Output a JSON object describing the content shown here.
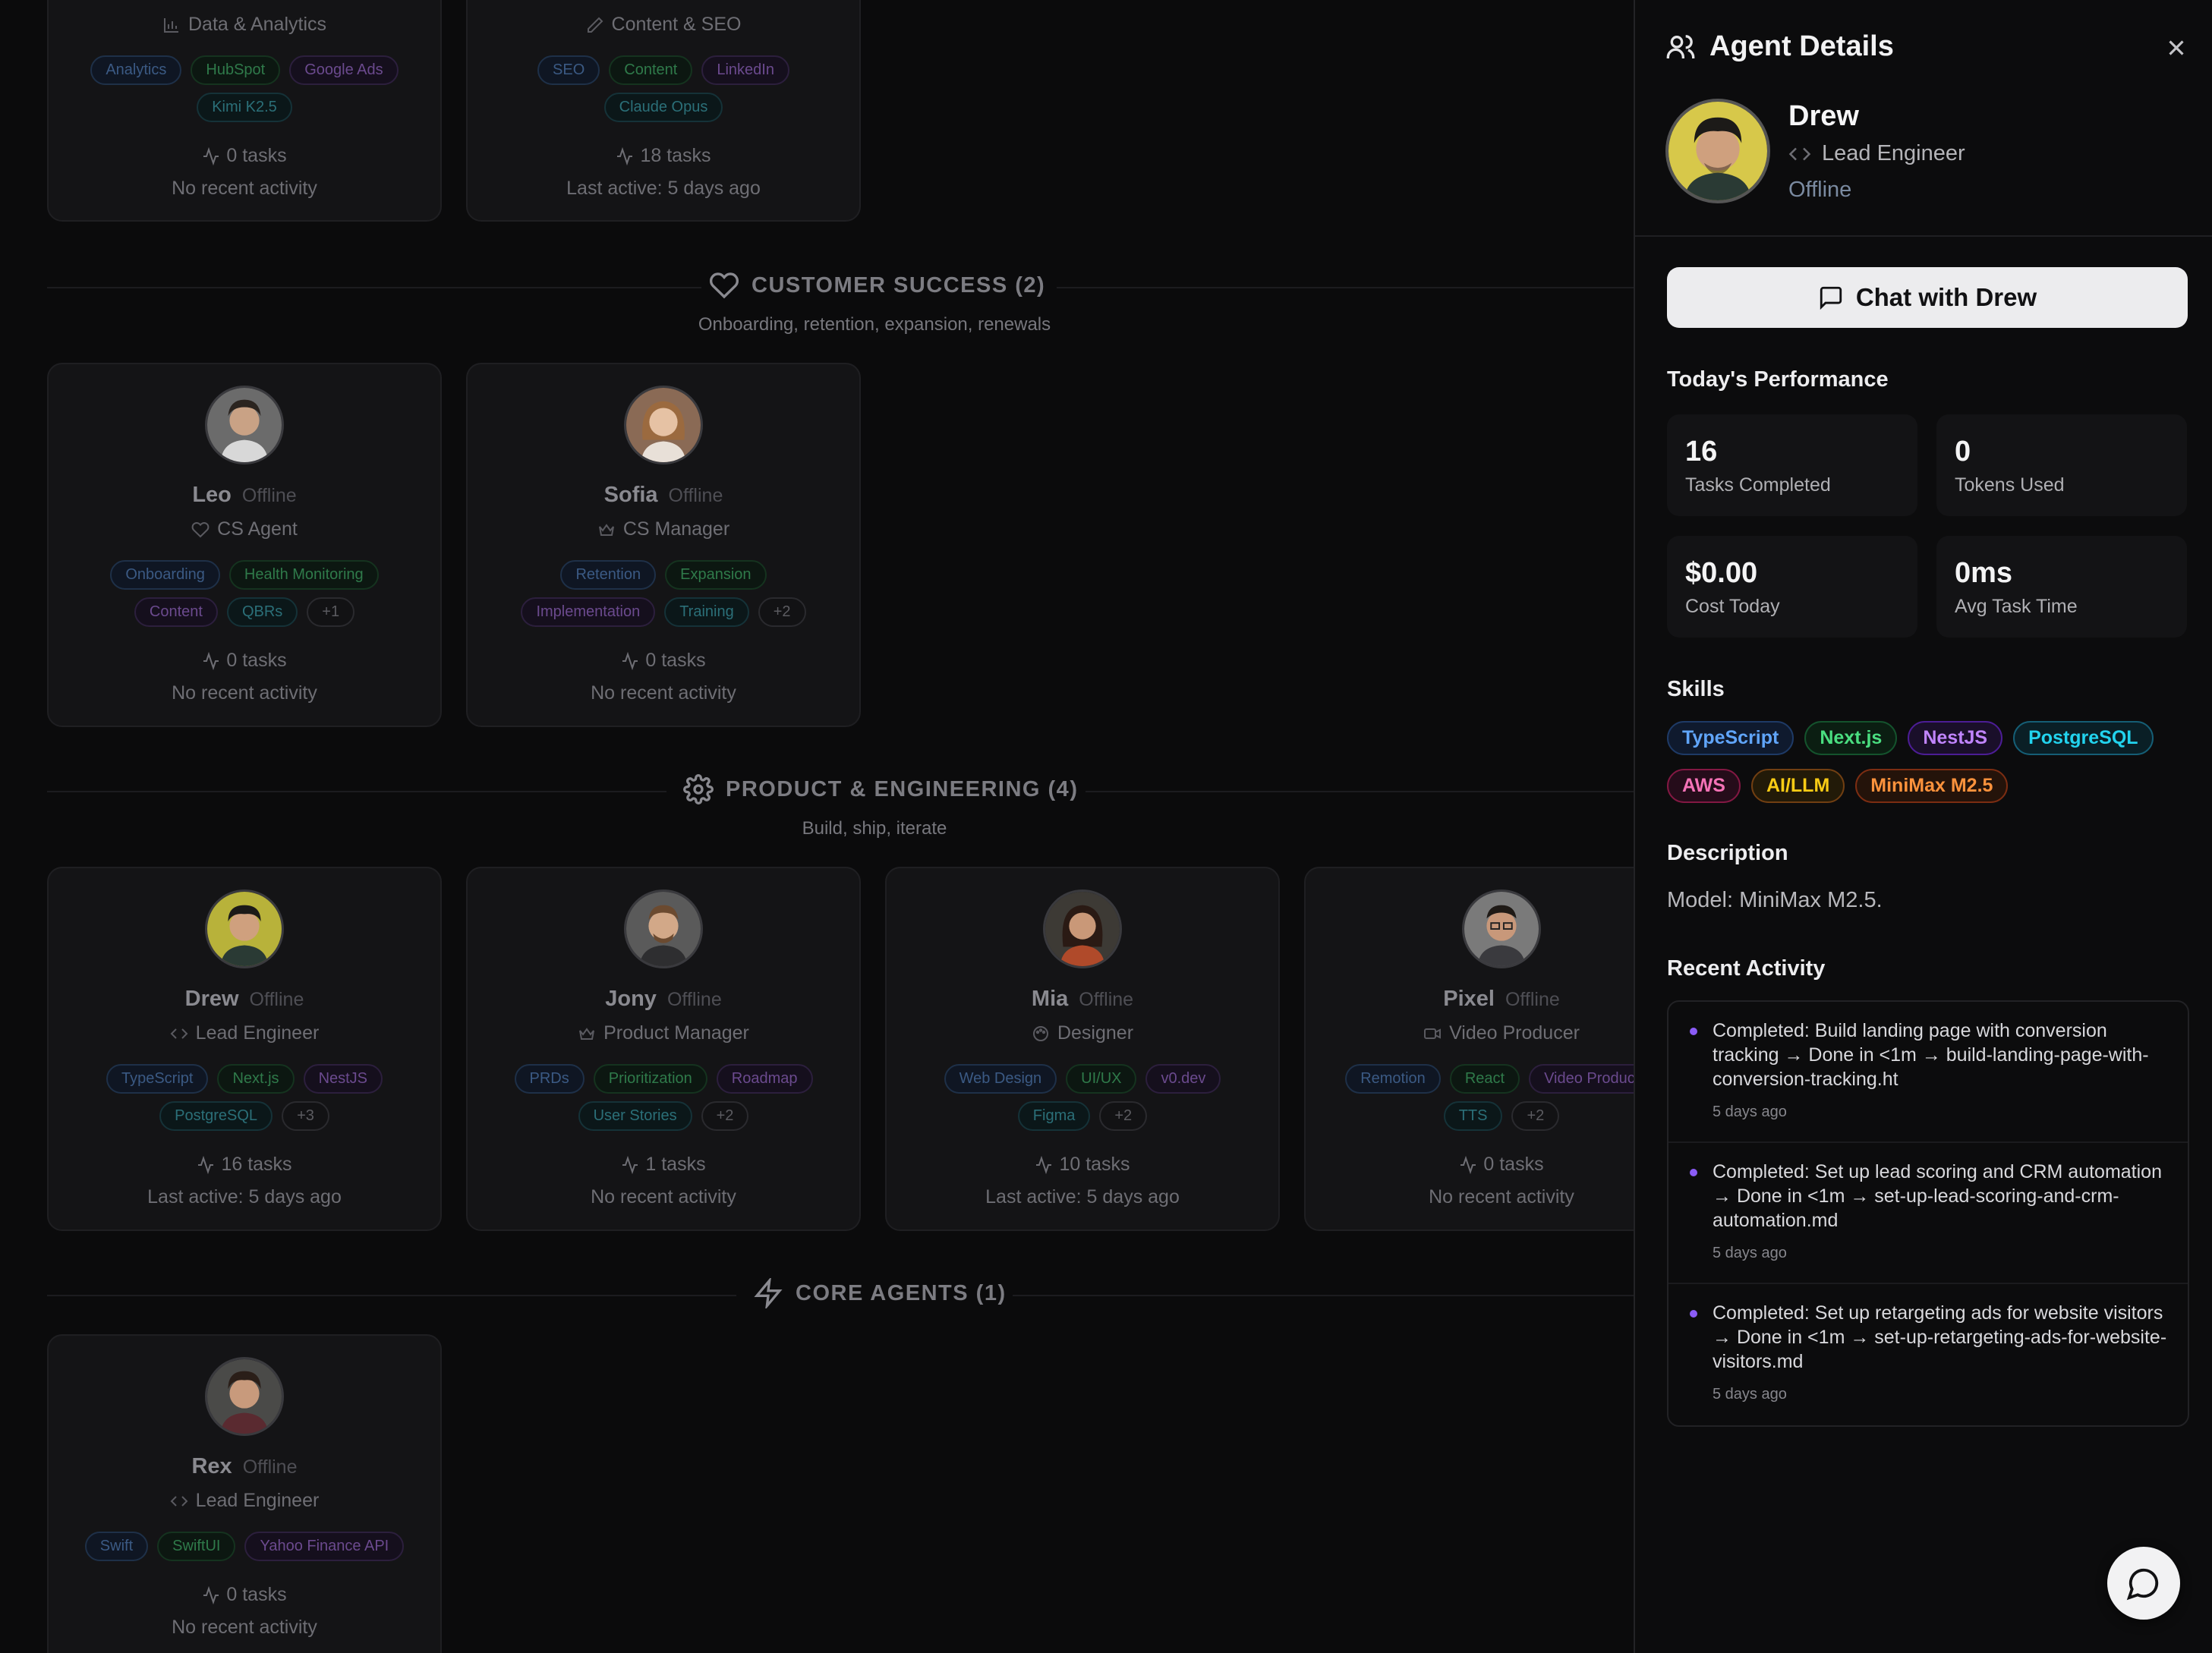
{
  "colors": {
    "accent_dot": "#8b5cf6",
    "chip_blue": "#3b82f6",
    "chip_green": "#22c55e",
    "chip_purple": "#a855f7",
    "chip_cyan": "#06b6d4",
    "chip_pink": "#ec4899",
    "chip_yellow": "#eab308",
    "chip_orange": "#f97316"
  },
  "top_row": {
    "card1": {
      "role": "Data & Analytics",
      "role_icon": "bar-chart-icon",
      "chips": [
        "Analytics",
        "HubSpot",
        "Google Ads",
        "Kimi K2.5"
      ],
      "tasks": "0 tasks",
      "activity": "No recent activity"
    },
    "card2": {
      "role": "Content & SEO",
      "role_icon": "pen-icon",
      "chips": [
        "SEO",
        "Content",
        "LinkedIn",
        "Claude Opus"
      ],
      "tasks": "18 tasks",
      "activity": "Last active: 5 days ago"
    }
  },
  "sections": {
    "customer_success": {
      "title": "CUSTOMER SUCCESS (2)",
      "icon": "heart-icon",
      "subtitle": "Onboarding, retention, expansion, renewals",
      "agents": [
        {
          "name": "Leo",
          "status": "Offline",
          "role": "CS Agent",
          "role_icon": "heart-icon",
          "chips": [
            "Onboarding",
            "Health Monitoring",
            "Content",
            "QBRs",
            "+1"
          ],
          "tasks": "0 tasks",
          "activity": "No recent activity"
        },
        {
          "name": "Sofia",
          "status": "Offline",
          "role": "CS Manager",
          "role_icon": "crown-icon",
          "chips": [
            "Retention",
            "Expansion",
            "Implementation",
            "Training",
            "+2"
          ],
          "tasks": "0 tasks",
          "activity": "No recent activity"
        }
      ]
    },
    "product_engineering": {
      "title": "PRODUCT & ENGINEERING (4)",
      "icon": "gear-icon",
      "subtitle": "Build, ship, iterate",
      "agents": [
        {
          "name": "Drew",
          "status": "Offline",
          "role": "Lead Engineer",
          "role_icon": "code-icon",
          "chips": [
            "TypeScript",
            "Next.js",
            "NestJS",
            "PostgreSQL",
            "+3"
          ],
          "tasks": "16 tasks",
          "activity": "Last active: 5 days ago"
        },
        {
          "name": "Jony",
          "status": "Offline",
          "role": "Product Manager",
          "role_icon": "crown-icon",
          "chips": [
            "PRDs",
            "Prioritization",
            "Roadmap",
            "User Stories",
            "+2"
          ],
          "tasks": "1 tasks",
          "activity": "No recent activity"
        },
        {
          "name": "Mia",
          "status": "Offline",
          "role": "Designer",
          "role_icon": "palette-icon",
          "chips": [
            "Web Design",
            "UI/UX",
            "v0.dev",
            "Figma",
            "+2"
          ],
          "tasks": "10 tasks",
          "activity": "Last active: 5 days ago"
        },
        {
          "name": "Pixel",
          "status": "Offline",
          "role": "Video Producer",
          "role_icon": "video-icon",
          "chips": [
            "Remotion",
            "React",
            "Video Producti",
            "TTS",
            "+2"
          ],
          "tasks": "0 tasks",
          "activity": "No recent activity"
        }
      ]
    },
    "core_agents": {
      "title": "CORE AGENTS (1)",
      "icon": "lightning-icon",
      "agents": [
        {
          "name": "Rex",
          "status": "Offline",
          "role": "Lead Engineer",
          "role_icon": "code-icon",
          "chips": [
            "Swift",
            "SwiftUI",
            "Yahoo Finance API"
          ],
          "tasks": "0 tasks",
          "activity": "No recent activity"
        }
      ]
    }
  },
  "panel": {
    "title": "Agent Details",
    "title_icon": "users-icon",
    "close_icon": "close-icon",
    "agent": {
      "name": "Drew",
      "role": "Lead Engineer",
      "role_icon": "code-icon",
      "status": "Offline"
    },
    "chat_button": "Chat with Drew",
    "performance": {
      "heading": "Today's Performance",
      "stats": [
        {
          "value": "16",
          "label": "Tasks Completed"
        },
        {
          "value": "0",
          "label": "Tokens Used"
        },
        {
          "value": "$0.00",
          "label": "Cost Today"
        },
        {
          "value": "0ms",
          "label": "Avg Task Time"
        }
      ]
    },
    "skills": {
      "heading": "Skills",
      "items": [
        "TypeScript",
        "Next.js",
        "NestJS",
        "PostgreSQL",
        "AWS",
        "AI/LLM",
        "MiniMax M2.5"
      ]
    },
    "description": {
      "heading": "Description",
      "text": "Model: MiniMax M2.5."
    },
    "recent_activity": {
      "heading": "Recent Activity",
      "items": [
        {
          "text": "Completed: Build landing page with conversion tracking → Done in <1m → build-landing-page-with-conversion-tracking.ht",
          "time": "5 days ago"
        },
        {
          "text": "Completed: Set up lead scoring and CRM automation → Done in <1m → set-up-lead-scoring-and-crm-automation.md",
          "time": "5 days ago"
        },
        {
          "text": "Completed: Set up retargeting ads for website visitors → Done in <1m → set-up-retargeting-ads-for-website-visitors.md",
          "time": "5 days ago"
        }
      ]
    },
    "fab_icon": "chat-bubble-icon"
  }
}
